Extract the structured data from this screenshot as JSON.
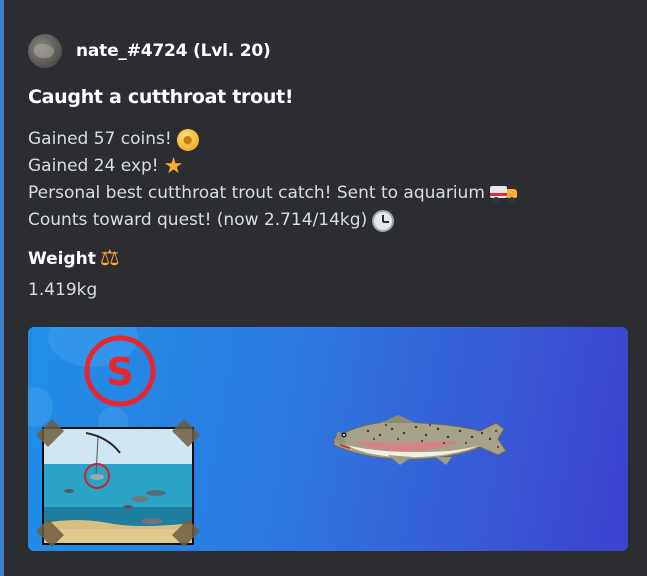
{
  "author": {
    "name": "nate_#4724 (Lvl. 20)"
  },
  "embed": {
    "title": "Caught a cutthroat trout!",
    "description_lines": [
      {
        "text": "Gained 57 coins!",
        "icon": "coin-icon"
      },
      {
        "text": "Gained 24 exp!",
        "icon": "star-icon"
      },
      {
        "text": "Personal best cutthroat trout catch! Sent to aquarium",
        "icon": "delivery-truck-icon"
      },
      {
        "text": "Counts toward quest! (now 2.714/14kg)",
        "icon": "clock-icon"
      }
    ],
    "fields": [
      {
        "name": "Weight",
        "icon": "balance-scale-icon",
        "value": "1.419kg"
      }
    ],
    "badge_letter": "S"
  },
  "colors": {
    "embed_border": "#3b82c8",
    "embed_background": "#2b2d31",
    "badge_red": "#e8262b"
  }
}
